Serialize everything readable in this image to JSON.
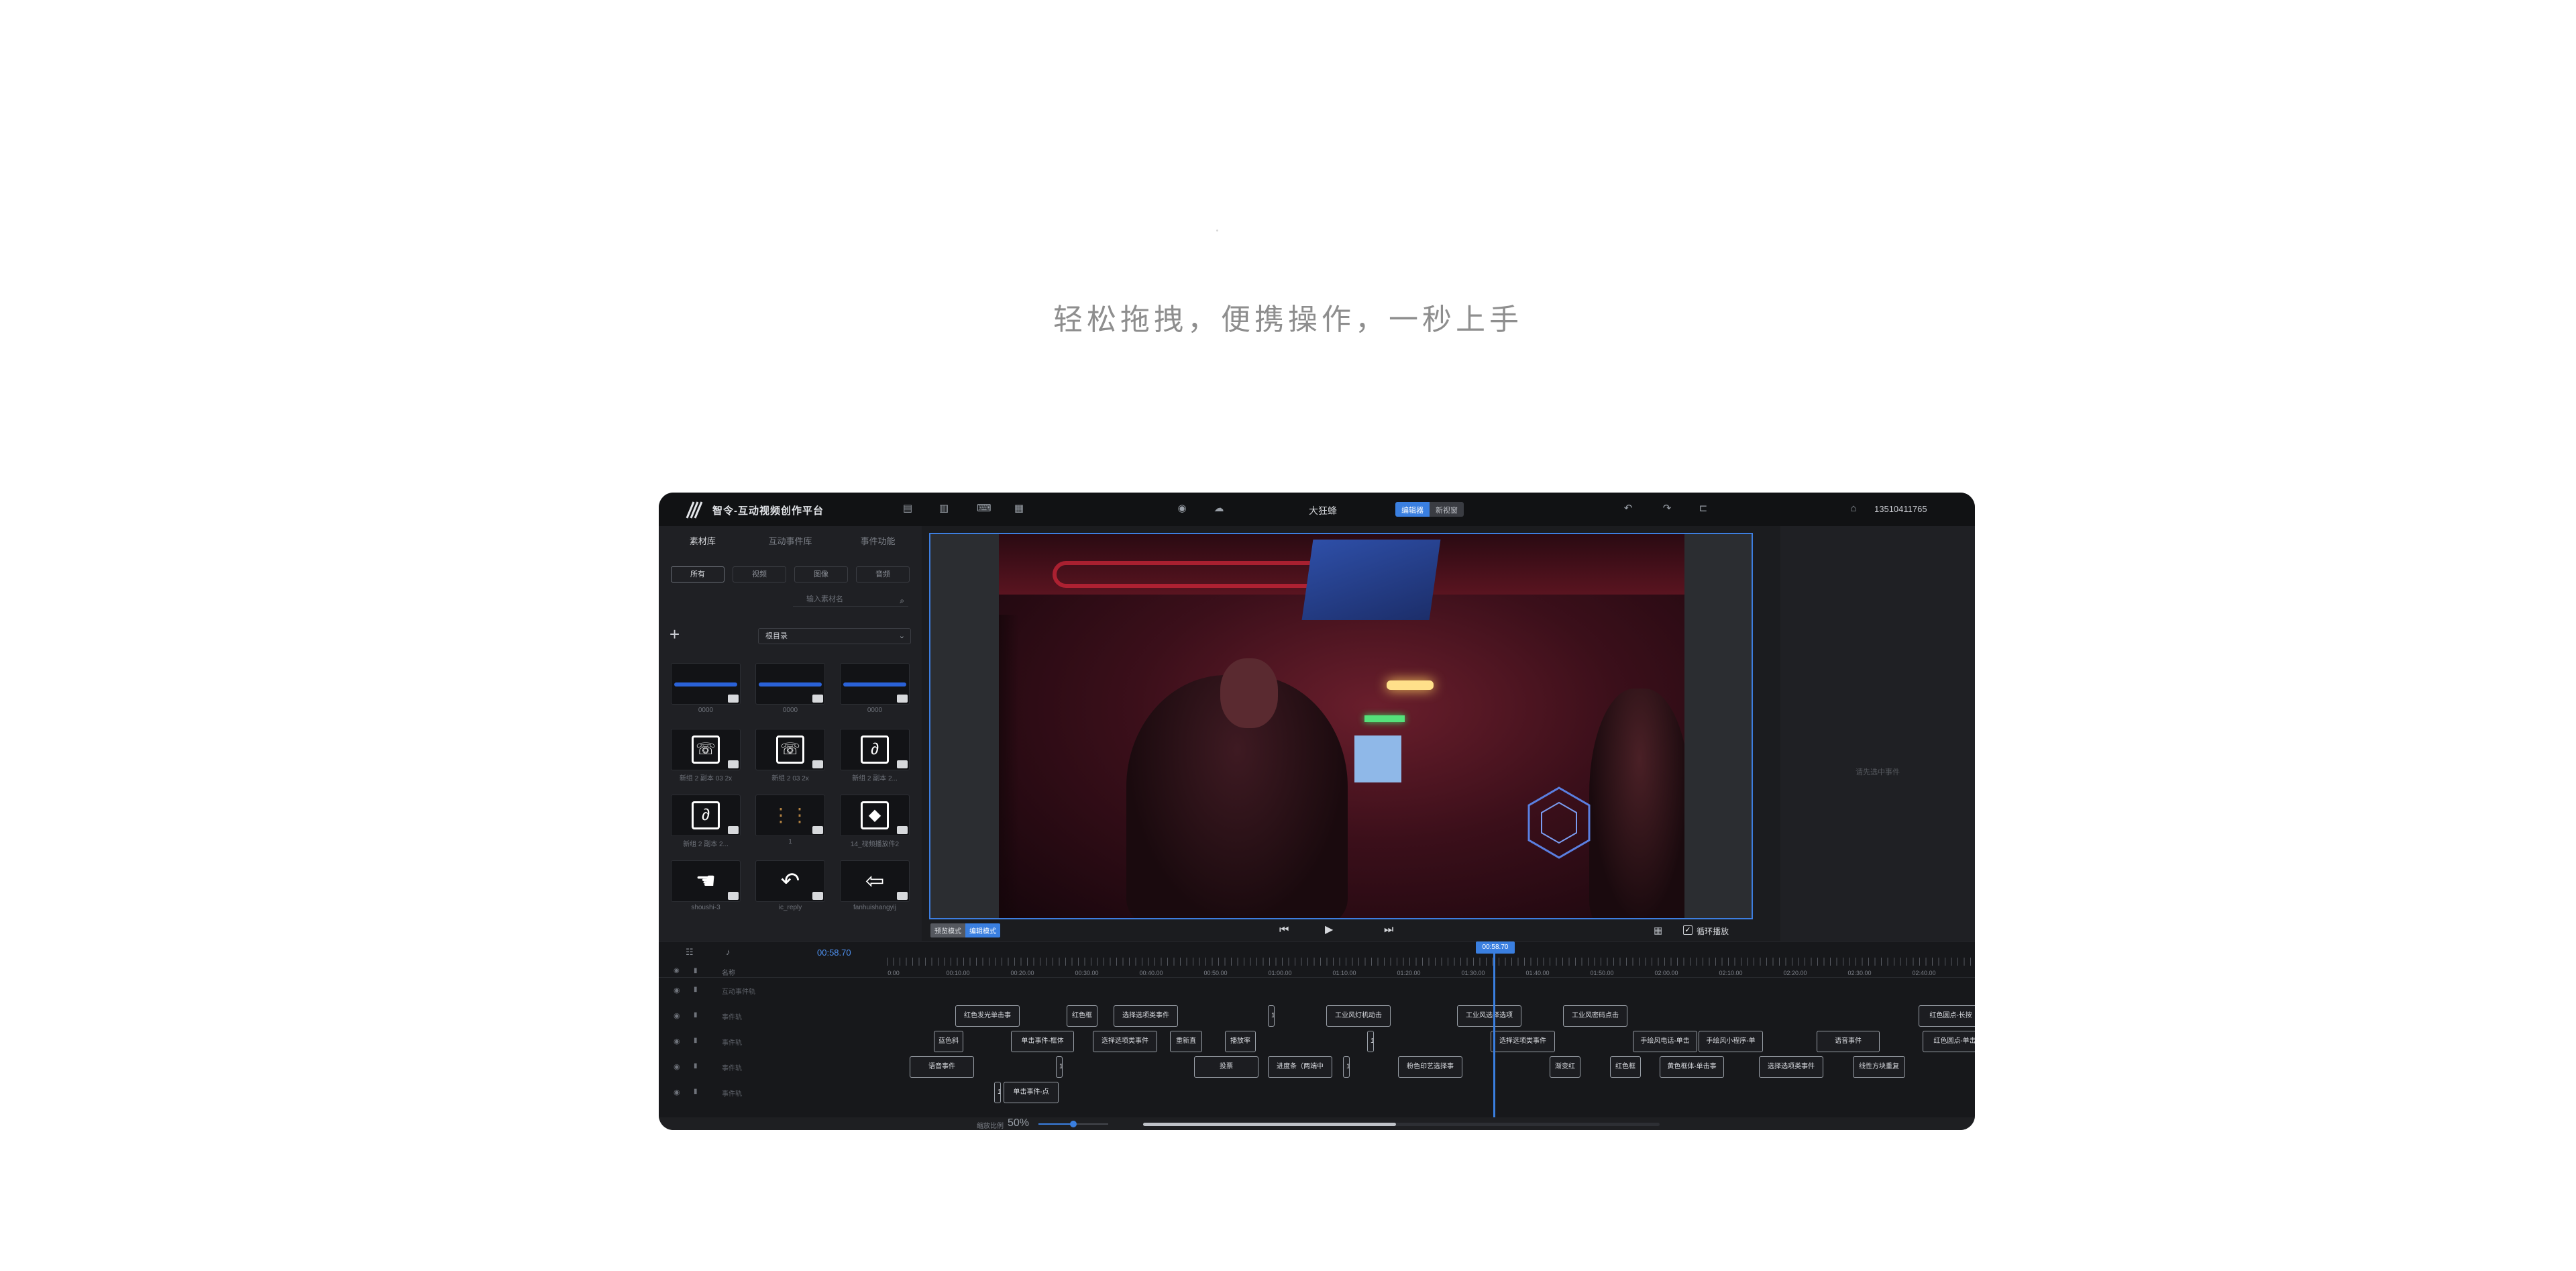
{
  "page": {
    "headline": "轻松拖拽，便携操作，一秒上手"
  },
  "app": {
    "title": "智令-互动视频创作平台",
    "doc_title": "大狂蜂",
    "mode_on": "编辑器",
    "mode_off": "新视窗",
    "phone": "13510411765"
  },
  "left": {
    "tabs": [
      "素材库",
      "互动事件库",
      "事件功能"
    ],
    "filters": [
      "所有",
      "视频",
      "图像",
      "音频"
    ],
    "search_placeholder": "输入素材名",
    "dir": "根目录",
    "assets": [
      {
        "cap": "0000",
        "kind": "wave"
      },
      {
        "cap": "0000",
        "kind": "wave"
      },
      {
        "cap": "0000",
        "kind": "wave"
      },
      {
        "cap": "新组 2 副本 03 2x",
        "kind": "phone",
        "glyph": "☏"
      },
      {
        "cap": "新组 2 03 2x",
        "kind": "phone",
        "glyph": "☏"
      },
      {
        "cap": "新组 2 副本 2...",
        "kind": "link",
        "glyph": "∂"
      },
      {
        "cap": "新组 2 副本 2...",
        "kind": "link",
        "glyph": "∂"
      },
      {
        "cap": "1",
        "kind": "keypad",
        "glyph": "⋮⋮"
      },
      {
        "cap": "14_视频播放件2",
        "kind": "diamond",
        "glyph": "◆"
      },
      {
        "cap": "shoushi-3",
        "kind": "hand",
        "glyph": "☚"
      },
      {
        "cap": "ic_reply",
        "kind": "reply",
        "glyph": "↶"
      },
      {
        "cap": "fanhuishangyij",
        "kind": "back",
        "glyph": "⇦"
      }
    ]
  },
  "preview": {
    "mode_off": "预览模式",
    "mode_on": "编辑模式",
    "loop_label": "循环播放"
  },
  "right": {
    "empty_hint": "请先选中事件"
  },
  "timeline": {
    "current_time": "00:58.70",
    "playhead_label": "00:58.70",
    "header_name": "名称",
    "ruler_labels": [
      "0:00",
      "00:10.00",
      "00:20.00",
      "00:30.00",
      "00:40.00",
      "00:50.00",
      "01:00.00",
      "01:10.00",
      "01:20.00",
      "01:30.00",
      "01:40.00",
      "01:50.00",
      "02:00.00",
      "02:10.00",
      "02:20.00",
      "02:30.00",
      "02:40.00",
      "02:50.00"
    ],
    "track_names": [
      "互动事件轨",
      "事件轨",
      "事件轨",
      "事件轨",
      "事件轨"
    ],
    "events": [
      {
        "track": 1,
        "text": "红色发光单击事"
      },
      {
        "track": 1,
        "text": "红色框"
      },
      {
        "track": 1,
        "text": "选择选项类事件"
      },
      {
        "track": 1,
        "text": "1"
      },
      {
        "track": 1,
        "text": "工业风灯机动击"
      },
      {
        "track": 1,
        "text": "工业风选择选项"
      },
      {
        "track": 1,
        "text": "工业风密码点击"
      },
      {
        "track": 1,
        "text": "红色圆点-长按"
      },
      {
        "track": 2,
        "text": "蓝色斜"
      },
      {
        "track": 2,
        "text": "单击事件-框体"
      },
      {
        "track": 2,
        "text": "选择选项类事件"
      },
      {
        "track": 2,
        "text": "重新直"
      },
      {
        "track": 2,
        "text": "播放率"
      },
      {
        "track": 2,
        "text": "1"
      },
      {
        "track": 2,
        "text": "选择选项类事件"
      },
      {
        "track": 2,
        "text": "手绘风电话-单击"
      },
      {
        "track": 2,
        "text": "手绘风小程序-单"
      },
      {
        "track": 2,
        "text": "语音事件"
      },
      {
        "track": 2,
        "text": "红色圆点-单击"
      },
      {
        "track": 3,
        "text": "语音事件"
      },
      {
        "track": 3,
        "text": "1"
      },
      {
        "track": 3,
        "text": "投票"
      },
      {
        "track": 3,
        "text": "进度条（两端中"
      },
      {
        "track": 3,
        "text": "1"
      },
      {
        "track": 3,
        "text": "粉色印艺选择事"
      },
      {
        "track": 3,
        "text": "渐变红"
      },
      {
        "track": 3,
        "text": "红色框"
      },
      {
        "track": 3,
        "text": "黄色框体-单击事"
      },
      {
        "track": 3,
        "text": "选择选项类事件"
      },
      {
        "track": 3,
        "text": "线性方块重复"
      },
      {
        "track": 4,
        "text": "1"
      },
      {
        "track": 4,
        "text": "单击事件-点"
      }
    ],
    "zoom_label": "缩放比例",
    "zoom_value": "50%",
    "zoom_fraction": 0.5,
    "scroll_fraction": 0.49
  }
}
